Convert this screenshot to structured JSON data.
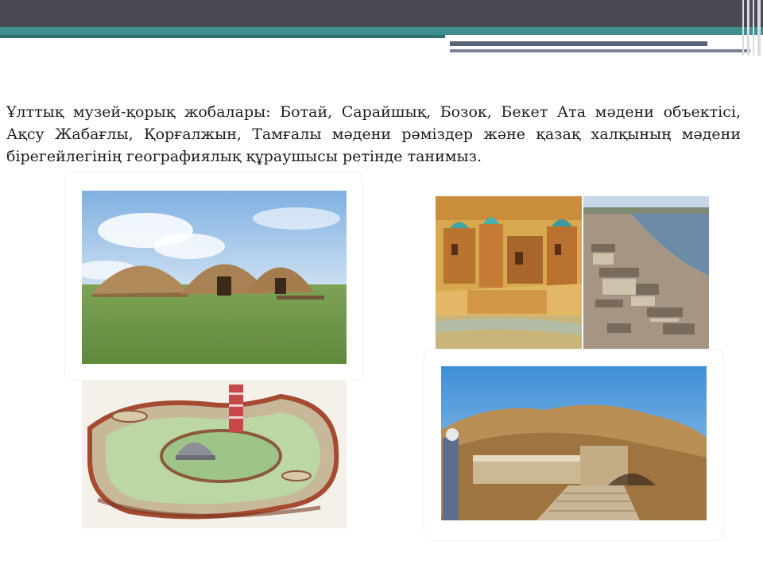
{
  "slide": {
    "text": "Ұлттық музей-қорық жобалары: Ботай, Сарайшық, Бозок,  Бекет Ата мәдени объектісі, Ақсу Жабағлы, Қорғалжын, Тамғалы мәдени рәміздер және қазақ халқының мәдени бірегейлегінің географиялық құраушысы  ретінде  танимыз."
  },
  "images": [
    {
      "name": "botai-dwellings",
      "icon": "mound-houses-photo"
    },
    {
      "name": "saraishyk-painting",
      "icon": "ancient-city-painting"
    },
    {
      "name": "saraishyk-ruins",
      "icon": "excavation-ruins-photo"
    },
    {
      "name": "bozok-reconstruction",
      "icon": "fortress-reconstruction-drawing"
    },
    {
      "name": "beket-ata-mosque",
      "icon": "underground-mosque-photo"
    }
  ]
}
